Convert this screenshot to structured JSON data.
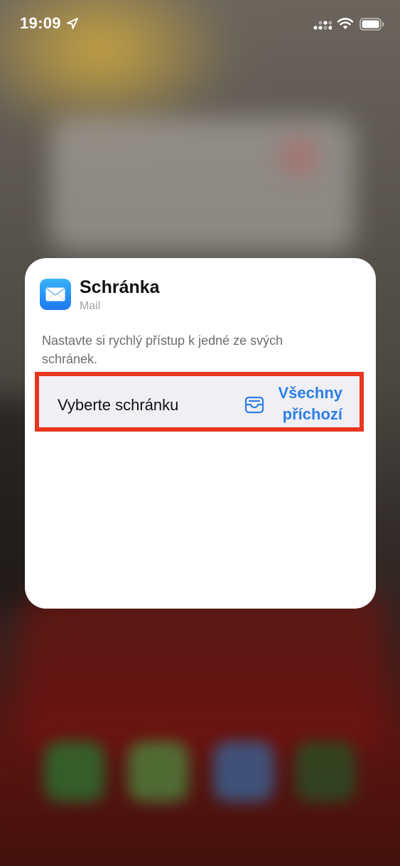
{
  "status_bar": {
    "time": "19:09"
  },
  "widget": {
    "title": "Schránka",
    "app_name": "Mail",
    "description": "Nastavte si rychlý přístup k jedné ze svých schránek.",
    "mailbox_row": {
      "label": "Vyberte schránku",
      "value": "Všechny příchozí",
      "icon": "inbox-tray-icon"
    },
    "app_icon": "mail-envelope-icon"
  },
  "colors": {
    "accent": "#2e7fe6",
    "highlight_border": "#e8351f",
    "row_background": "#f0eff4",
    "card_background": "#ffffff"
  }
}
